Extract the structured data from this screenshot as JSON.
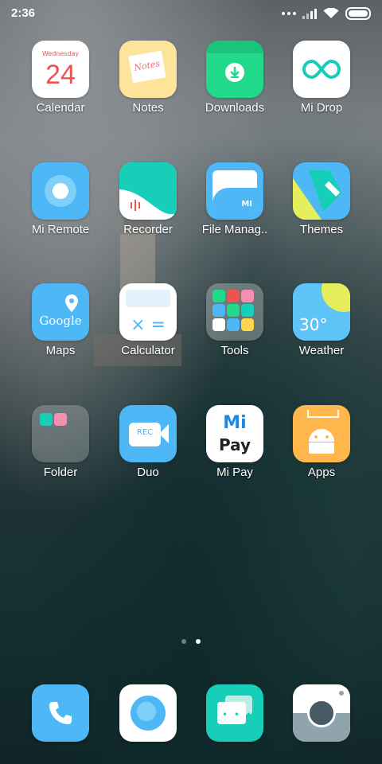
{
  "status": {
    "time": "2:36"
  },
  "apps": {
    "calendar": {
      "label": "Calendar",
      "weekday": "Wednesday",
      "day": "24"
    },
    "notes": {
      "label": "Notes",
      "card": "Notes"
    },
    "downloads": {
      "label": "Downloads"
    },
    "midrop": {
      "label": "Mi Drop"
    },
    "miremote": {
      "label": "Mi Remote"
    },
    "recorder": {
      "label": "Recorder"
    },
    "filemanager": {
      "label": "File Manag..",
      "brand": "MI"
    },
    "themes": {
      "label": "Themes"
    },
    "maps": {
      "label": "Maps",
      "brand": "Google"
    },
    "calculator": {
      "label": "Calculator",
      "symbols": "× ="
    },
    "tools": {
      "label": "Tools"
    },
    "weather": {
      "label": "Weather",
      "temp": "30°"
    },
    "folder": {
      "label": "Folder"
    },
    "duo": {
      "label": "Duo",
      "badge": "REC"
    },
    "mipay": {
      "label": "Mi Pay",
      "brand_top": "Mi",
      "brand_bottom": "Pay"
    },
    "apps": {
      "label": "Apps"
    }
  },
  "dock": [
    "phone-icon",
    "browser-icon",
    "messages-icon",
    "camera-icon"
  ],
  "pager": {
    "active_index": 1,
    "count": 2
  },
  "colors": {
    "calendar_red": "#ef5350",
    "downloads_green": "#21d98a",
    "blue": "#4db8f5",
    "teal": "#17cfb8"
  }
}
